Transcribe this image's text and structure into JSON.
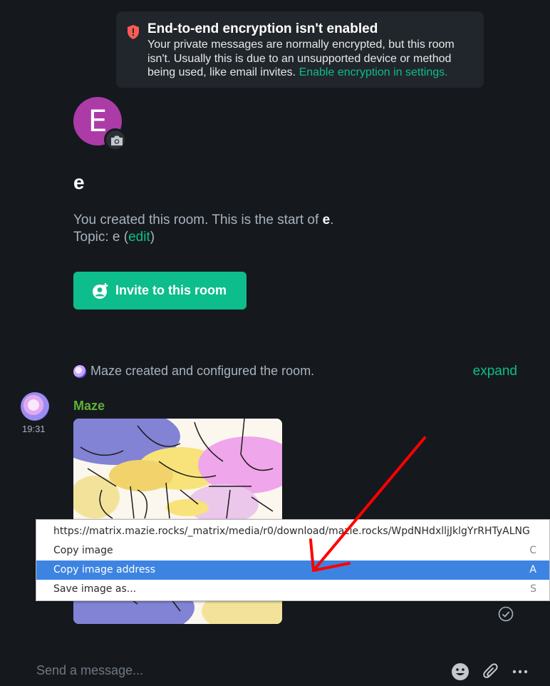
{
  "colors": {
    "background": "#15191e",
    "accent": "#0dbd8b",
    "warning": "#ff5b55",
    "room_avatar": "#ac3ba8",
    "sender_name": "#5fb236",
    "menu_highlight": "#3d84e2",
    "annotation_arrow": "#ff0000"
  },
  "encryption_banner": {
    "icon": "shield-error-icon",
    "title": "End-to-end encryption isn't enabled",
    "body_line1": "Your private messages are normally encrypted, but this room",
    "body_line2": "isn't. Usually this is due to an unsupported device or method",
    "body_line3": "being used, like email invites.",
    "link": "Enable encryption in settings."
  },
  "room": {
    "avatar_letter": "E",
    "camera_icon": "camera-icon",
    "name": "e",
    "intro_prefix": "You created this room. This is the start of",
    "intro_room": "e",
    "intro_suffix": ".",
    "topic_prefix": "Topic: e (",
    "topic_edit": "edit",
    "topic_suffix": ")",
    "invite_icon": "user-add-icon",
    "invite_label": "Invite to this room"
  },
  "timeline": {
    "created_text": "Maze created and configured the room.",
    "expand": "expand",
    "message": {
      "sender": "Maze",
      "time": "19:31"
    }
  },
  "context_menu": {
    "items": [
      {
        "label": "https://matrix.mazie.rocks/_matrix/media/r0/download/mazie.rocks/WpdNHdxlljJklgYrRHTyALNG",
        "key": ""
      },
      {
        "label": "Copy image",
        "key": "C"
      },
      {
        "label": "Copy image address",
        "key": "A"
      },
      {
        "label": "Save image as...",
        "key": "S"
      }
    ]
  },
  "composer": {
    "placeholder": "Send a message...",
    "icons": [
      "emoji-icon",
      "attachment-icon",
      "more-options-icon"
    ]
  }
}
